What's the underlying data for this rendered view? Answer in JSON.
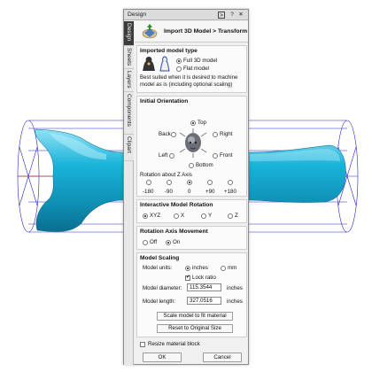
{
  "window": {
    "title": "Design",
    "buttons": [
      "pin-icon",
      "help-icon",
      "close-icon"
    ]
  },
  "tabs": [
    {
      "label": "Design",
      "active": true
    },
    {
      "label": "Sheets",
      "active": false
    },
    {
      "label": "Layers",
      "active": false
    },
    {
      "label": "Components",
      "active": false
    },
    {
      "label": "Clipart",
      "active": false
    }
  ],
  "header": {
    "breadcrumb": "Import 3D Model > Transform"
  },
  "model_type": {
    "title": "Imported model type",
    "options": [
      "Full 3D model",
      "Flat model"
    ],
    "selected": "Full 3D model",
    "description": "Best suited when it is desired to machine model as is (including optional scaling)"
  },
  "orientation": {
    "title": "Initial Orientation",
    "labels": {
      "top": "Top",
      "back": "Back",
      "right": "Right",
      "left": "Left",
      "front": "Front",
      "bottom": "Bottom"
    },
    "selected": "Top",
    "rotation_label": "Rotation about Z Axis",
    "rotation_values": [
      "-180",
      "-90",
      "0",
      "+90",
      "+180"
    ],
    "rotation_selected": "0"
  },
  "interactive_rotation": {
    "title": "Interactive Model Rotation",
    "options": [
      "XYZ",
      "X",
      "Y",
      "Z"
    ],
    "selected": "XYZ"
  },
  "axis_movement": {
    "title": "Rotation Axis Movement",
    "options": [
      "Off",
      "On"
    ],
    "selected": "On"
  },
  "scaling": {
    "title": "Model Scaling",
    "units_label": "Model units:",
    "units": [
      "inches",
      "mm"
    ],
    "units_selected": "inches",
    "lock_ratio": "Lock ratio",
    "lock_ratio_checked": true,
    "diameter_label": "Model diameter:",
    "diameter_value": "115.3544",
    "diameter_unit": "inches",
    "length_label": "Model length:",
    "length_value": "327.0516",
    "length_unit": "inches",
    "scale_button": "Scale model to fit material",
    "reset_button": "Reset to Original Size"
  },
  "resize_block": {
    "label": "Resize material block",
    "checked": false
  },
  "footer": {
    "ok": "OK",
    "cancel": "Cancel"
  },
  "colors": {
    "model": "#1aa5c8",
    "wireframe": "#2a2ad0",
    "panel": "#f0f0f0",
    "active_tab": "#3c3c3c"
  }
}
